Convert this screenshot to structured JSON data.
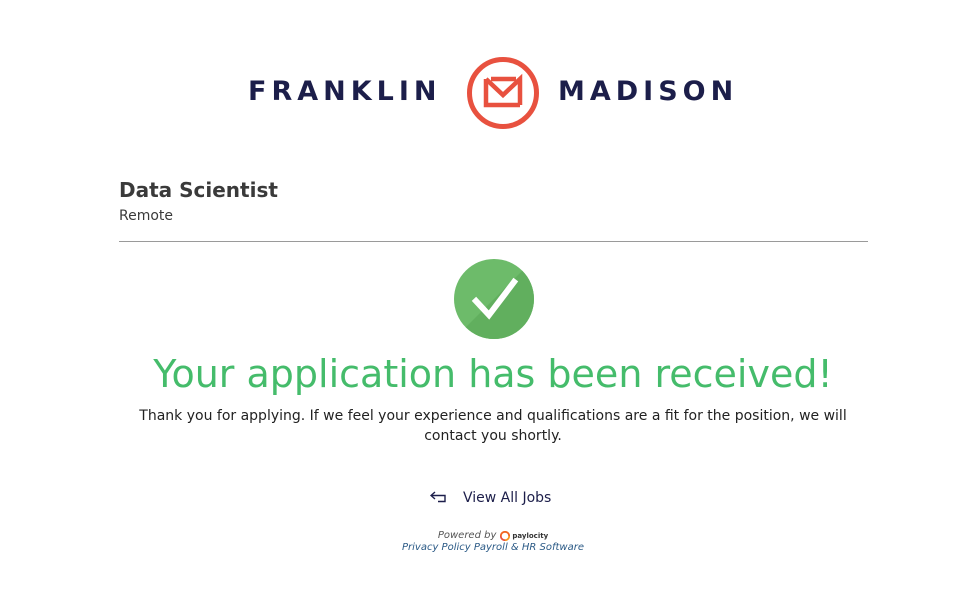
{
  "logo": {
    "left_word": "FRANKLIN",
    "right_word": "MADISON",
    "mark_icon": "fm-circle-logo",
    "text_color": "#1c1e4a",
    "mark_color": "#e8513f"
  },
  "job": {
    "title": "Data Scientist",
    "location": "Remote"
  },
  "confirmation": {
    "icon": "checkmark-circle-icon",
    "heading": "Your application has been received!",
    "message": "Thank you for applying. If we feel your experience and qualifications are a fit for the position, we will contact you shortly.",
    "accent_color": "#45bc6b"
  },
  "actions": {
    "view_all_jobs_label": "View All Jobs",
    "view_all_jobs_icon": "back-arrow-icon"
  },
  "footer": {
    "powered_by": "Powered by",
    "brand": "paylocity",
    "privacy_policy": "Privacy Policy",
    "payroll_link": "Payroll & HR Software"
  }
}
